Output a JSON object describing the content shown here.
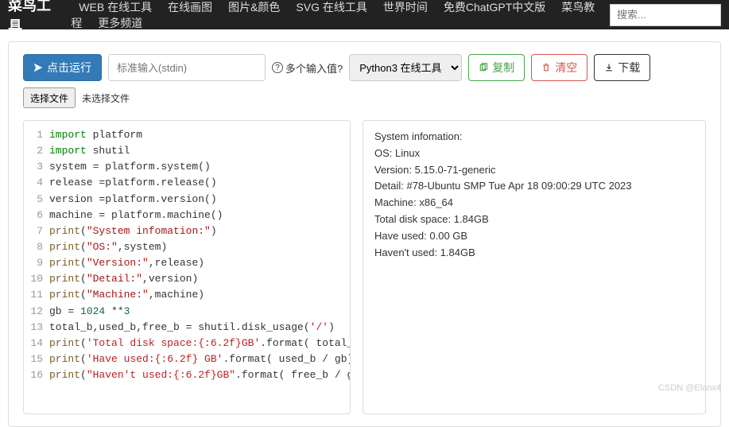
{
  "nav": {
    "brand": "菜鸟工具",
    "items": [
      "WEB 在线工具",
      "在线画图",
      "图片&颜色",
      "SVG 在线工具",
      "世界时间",
      "免费ChatGPT中文版",
      "菜鸟教程",
      "更多频道"
    ],
    "search_placeholder": "搜索..."
  },
  "toolbar": {
    "run": "点击运行",
    "stdin_placeholder": "标准输入(stdin)",
    "help": "多个输入值?",
    "compiler": "Python3 在线工具",
    "copy": "复制",
    "clear": "清空",
    "download": "下载",
    "choose_file": "选择文件",
    "no_file": "未选择文件"
  },
  "code": [
    [
      [
        "kw",
        "import"
      ],
      [
        "",
        " platform"
      ]
    ],
    [
      [
        "kw",
        "import"
      ],
      [
        "",
        " shutil"
      ]
    ],
    [
      [
        "",
        "system = platform.system()"
      ]
    ],
    [
      [
        "",
        "release =platform.release()"
      ]
    ],
    [
      [
        "",
        "version =platform.version()"
      ]
    ],
    [
      [
        "",
        "machine = platform.machine()"
      ]
    ],
    [
      [
        "call",
        "print"
      ],
      [
        "",
        "("
      ],
      [
        "str",
        "\"System infomation:\""
      ],
      [
        "",
        ")"
      ]
    ],
    [
      [
        "call",
        "print"
      ],
      [
        "",
        "("
      ],
      [
        "str",
        "\"OS:\""
      ],
      [
        "",
        ",system)"
      ]
    ],
    [
      [
        "call",
        "print"
      ],
      [
        "",
        "("
      ],
      [
        "str",
        "\"Version:\""
      ],
      [
        "",
        ",release)"
      ]
    ],
    [
      [
        "call",
        "print"
      ],
      [
        "",
        "("
      ],
      [
        "str",
        "\"Detail:\""
      ],
      [
        "",
        ",version)"
      ]
    ],
    [
      [
        "call",
        "print"
      ],
      [
        "",
        "("
      ],
      [
        "str",
        "\"Machine:\""
      ],
      [
        "",
        ",machine)"
      ]
    ],
    [
      [
        "",
        "gb = "
      ],
      [
        "num",
        "1024"
      ],
      [
        "",
        " **"
      ],
      [
        "num",
        "3"
      ]
    ],
    [
      [
        "",
        "total_b,used_b,free_b = shutil.disk_usage("
      ],
      [
        "str2",
        "'/'"
      ],
      [
        "",
        ")"
      ]
    ],
    [
      [
        "call",
        "print"
      ],
      [
        "",
        "("
      ],
      [
        "str2",
        "'Total disk space:{:6.2f}GB'"
      ],
      [
        "",
        ".format( total_b / gb))"
      ]
    ],
    [
      [
        "call",
        "print"
      ],
      [
        "",
        "("
      ],
      [
        "str2",
        "'Have used:{:6.2f} GB'"
      ],
      [
        "",
        ".format( used_b / gb))"
      ]
    ],
    [
      [
        "call",
        "print"
      ],
      [
        "",
        "("
      ],
      [
        "str2",
        "\"Haven't used:{:6.2f}GB\""
      ],
      [
        "",
        ".format( free_b / gb))"
      ]
    ]
  ],
  "output": [
    "System infomation:",
    "OS: Linux",
    "Version: 5.15.0-71-generic",
    "Detail: #78-Ubuntu SMP Tue Apr 18 09:00:29 UTC 2023",
    "Machine: x86_64",
    "Total disk space:  1.84GB",
    "Have used:  0.00 GB",
    "Haven't used:  1.84GB"
  ],
  "watermark": "CSDN @Elanx4"
}
